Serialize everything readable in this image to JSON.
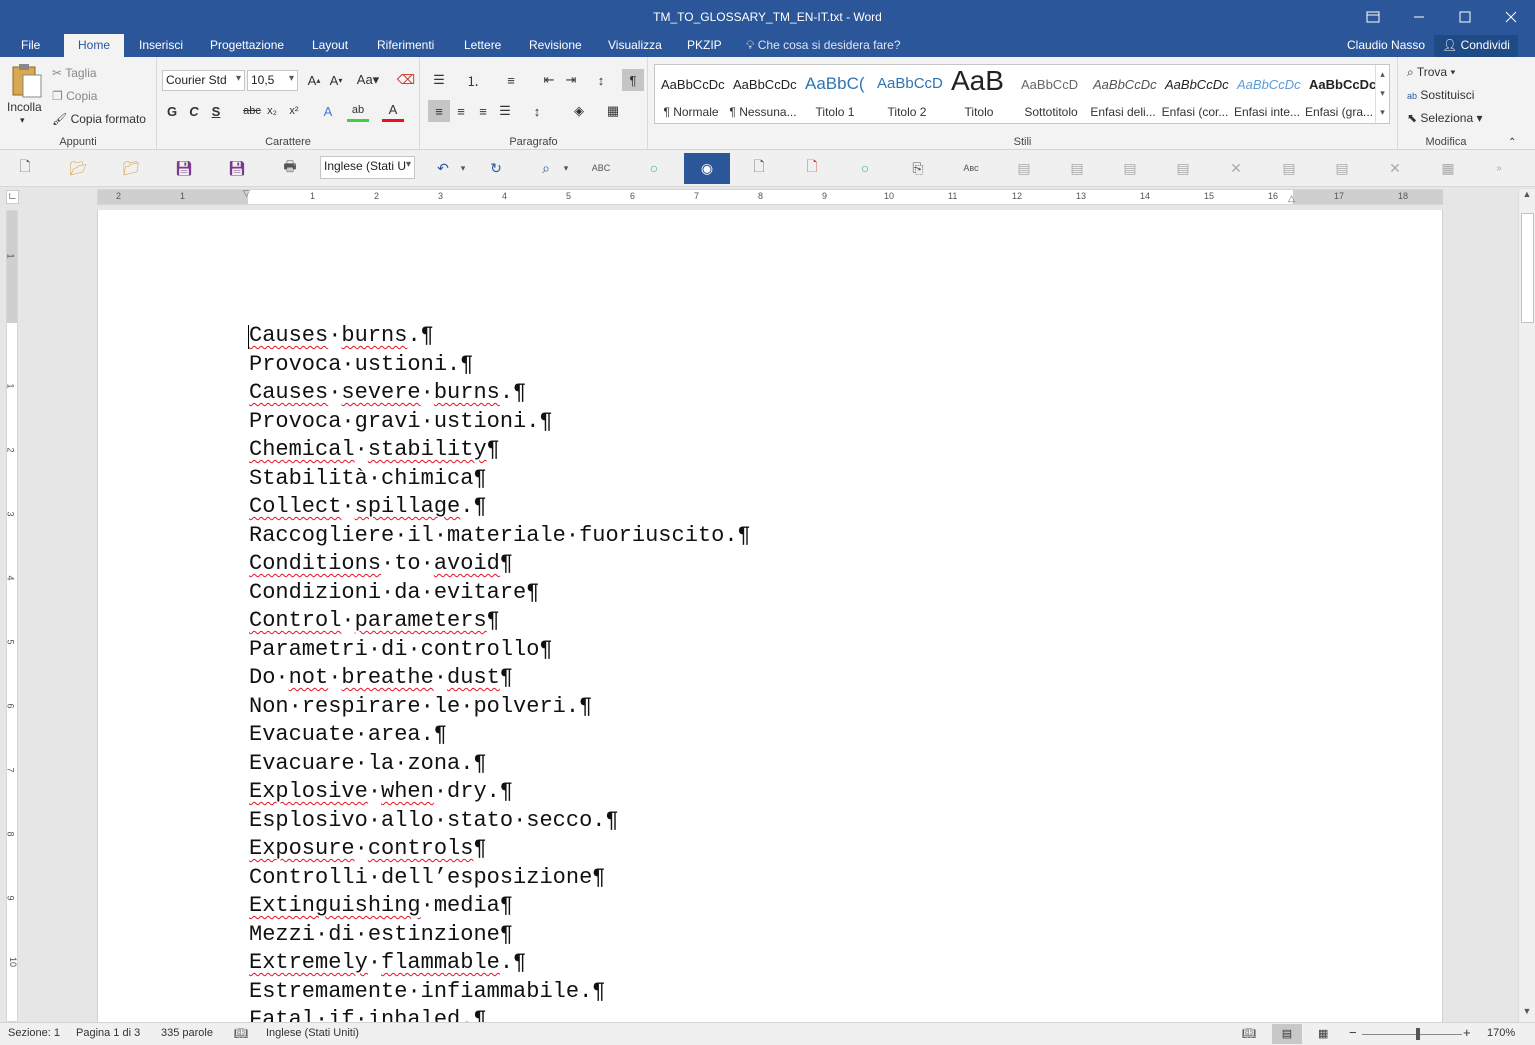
{
  "window": {
    "title": "TM_TO_GLOSSARY_TM_EN-IT.txt - Word"
  },
  "tabs": [
    {
      "label": "File"
    },
    {
      "label": "Home"
    },
    {
      "label": "Inserisci"
    },
    {
      "label": "Progettazione"
    },
    {
      "label": "Layout"
    },
    {
      "label": "Riferimenti"
    },
    {
      "label": "Lettere"
    },
    {
      "label": "Revisione"
    },
    {
      "label": "Visualizza"
    },
    {
      "label": "PKZIP"
    }
  ],
  "help": {
    "placeholder": "Che cosa si desidera fare?"
  },
  "user": {
    "name": "Claudio Nasso",
    "share_label": "Condividi"
  },
  "ribbon": {
    "clipboard": {
      "paste": "Incolla",
      "cut": "Taglia",
      "copy": "Copia",
      "format_painter": "Copia formato",
      "group": "Appunti"
    },
    "font": {
      "name": "Courier Std",
      "size": "10,5",
      "group": "Carattere"
    },
    "paragraph": {
      "group": "Paragrafo"
    },
    "styles": {
      "group": "Stili",
      "items": [
        {
          "preview": "AaBbCcDc",
          "name": "¶ Normale"
        },
        {
          "preview": "AaBbCcDc",
          "name": "¶ Nessuna..."
        },
        {
          "preview": "AaBbC(",
          "name": "Titolo 1"
        },
        {
          "preview": "AaBbCcD",
          "name": "Titolo 2"
        },
        {
          "preview": "AaB",
          "name": "Titolo"
        },
        {
          "preview": "AaBbCcD",
          "name": "Sottotitolo"
        },
        {
          "preview": "AaBbCcDc",
          "name": "Enfasi deli..."
        },
        {
          "preview": "AaBbCcDc",
          "name": "Enfasi (cor..."
        },
        {
          "preview": "AaBbCcDc",
          "name": "Enfasi inte..."
        },
        {
          "preview": "AaBbCcDc",
          "name": "Enfasi (gra..."
        }
      ]
    },
    "editing": {
      "find": "Trova",
      "replace": "Sostituisci",
      "select": "Seleziona",
      "group": "Modifica"
    }
  },
  "qat": {
    "language": "Inglese (Stati U"
  },
  "ruler": {
    "h_labels": [
      "2",
      "1",
      "1",
      "1",
      "2",
      "3",
      "4",
      "5",
      "6",
      "7",
      "8",
      "9",
      "10",
      "11",
      "12",
      "13",
      "14",
      "15",
      "16",
      "17",
      "18"
    ],
    "v_labels": [
      "1",
      "1",
      "2",
      "3",
      "4",
      "5",
      "6",
      "7",
      "8",
      "9",
      "10"
    ]
  },
  "document": {
    "lines": [
      "Causes·burns.¶",
      "Provoca·ustioni.¶",
      "Causes·severe·burns.¶",
      "Provoca·gravi·ustioni.¶",
      "Chemical·stability¶",
      "Stabilità·chimica¶",
      "Collect·spillage.¶",
      "Raccogliere·il·materiale·fuoriuscito.¶",
      "Conditions·to·avoid¶",
      "Condizioni·da·evitare¶",
      "Control·parameters¶",
      "Parametri·di·controllo¶",
      "Do·not·breathe·dust¶",
      "Non·respirare·le·polveri.¶",
      "Evacuate·area.¶",
      "Evacuare·la·zona.¶",
      "Explosive·when·dry.¶",
      "Esplosivo·allo·stato·secco.¶",
      "Exposure·controls¶",
      "Controlli·dell’esposizione¶",
      "Extinguishing·media¶",
      "Mezzi·di·estinzione¶",
      "Extremely·flammable.¶",
      "Estremamente·infiammabile.¶",
      "Fatal·if·inhaled.¶"
    ]
  },
  "status": {
    "section": "Sezione: 1",
    "page": "Pagina 1 di 3",
    "words": "335 parole",
    "language": "Inglese (Stati Uniti)",
    "zoom": "170%"
  },
  "colors": {
    "accent": "#2b579a",
    "spell_underline": "#e81123"
  }
}
